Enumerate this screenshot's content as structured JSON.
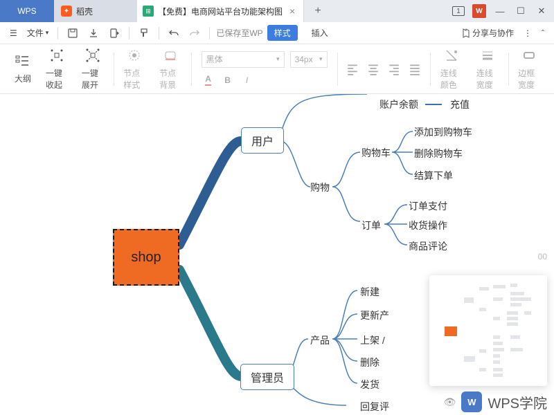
{
  "titlebar": {
    "wps_tab": "WPS",
    "docer_tab": "稻壳",
    "doc_title": "【免费】电商网站平台功能架构图",
    "badge": "1"
  },
  "menubar": {
    "file": "文件",
    "save_status": "已保存至WP",
    "style_btn": "样式",
    "insert": "插入",
    "share": "分享与协作"
  },
  "toolbar": {
    "outline": "大纲",
    "collapse_all": "一键收起",
    "expand_all": "一键展开",
    "node_style": "节点样式",
    "node_bg": "节点背景",
    "font_name": "黑体",
    "font_size": "34px",
    "line_color": "连线颜色",
    "line_width": "连线宽度",
    "border_width": "边框宽度"
  },
  "mindmap": {
    "root": "shop",
    "branch1": {
      "label": "用户",
      "n_balance": "账户余额",
      "n_recharge": "充值",
      "n_shopping": "购物",
      "n_cart": "购物车",
      "n_cart_add": "添加到购物车",
      "n_cart_del": "删除购物车",
      "n_checkout": "结算下单",
      "n_order": "订单",
      "n_pay": "订单支付",
      "n_receive": "收货操作",
      "n_review": "商品评论"
    },
    "branch2": {
      "label": "管理员",
      "n_product": "产品",
      "n_new": "新建",
      "n_update": "更新产",
      "n_shelf": "上架 / ",
      "n_delete": "删除",
      "n_ship": "发货",
      "n_reply": "回复评"
    }
  },
  "footer": {
    "watermark": "WPS学院",
    "logo": "W"
  },
  "zoom": "00"
}
